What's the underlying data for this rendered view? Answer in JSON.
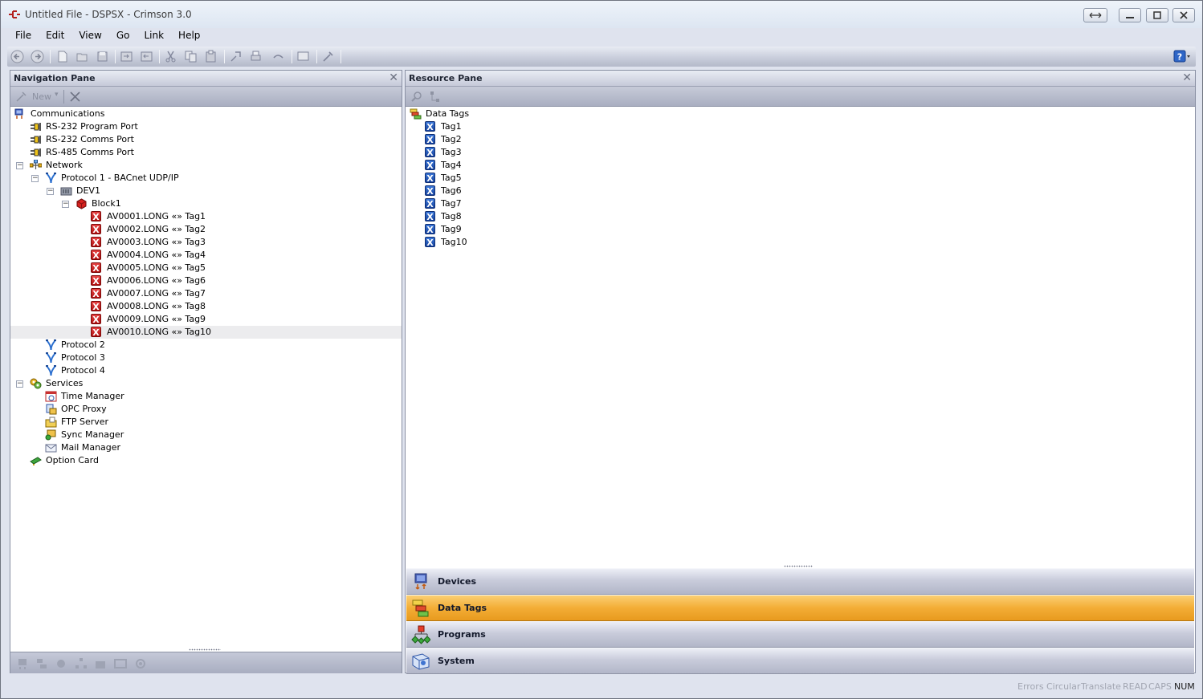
{
  "window": {
    "title": "Untitled File - DSPSX - Crimson 3.0",
    "controls": [
      "restore-down",
      "minimize",
      "maximize",
      "close"
    ]
  },
  "menu": [
    {
      "label": "File"
    },
    {
      "label": "Edit"
    },
    {
      "label": "View"
    },
    {
      "label": "Go"
    },
    {
      "label": "Link"
    },
    {
      "label": "Help"
    }
  ],
  "toolbar": {
    "icons": [
      "back-icon",
      "forward-icon",
      "new-file-icon",
      "open-icon",
      "save-icon",
      "import-icon",
      "export-icon",
      "cut-icon",
      "copy-icon",
      "paste-icon",
      "find-icon",
      "print-icon",
      "link-icon",
      "display-icon",
      "tool-icon"
    ],
    "help_icon": "help-icon"
  },
  "navigation_pane": {
    "title": "Navigation Pane",
    "new_label": "New",
    "tree": [
      {
        "label": "Communications",
        "icon": "communications-icon",
        "level": 0,
        "expander": ""
      },
      {
        "label": "RS-232 Program Port",
        "icon": "port-icon",
        "level": 1,
        "expander": ""
      },
      {
        "label": "RS-232 Comms Port",
        "icon": "port-icon",
        "level": 1,
        "expander": ""
      },
      {
        "label": "RS-485 Comms Port",
        "icon": "port-icon",
        "level": 1,
        "expander": ""
      },
      {
        "label": "Network",
        "icon": "network-icon",
        "level": 1,
        "expander": "−"
      },
      {
        "label": "Protocol 1 - BACnet UDP/IP",
        "icon": "protocol-icon",
        "level": 2,
        "expander": "−"
      },
      {
        "label": "DEV1",
        "icon": "device-icon",
        "level": 3,
        "expander": "−"
      },
      {
        "label": "Block1",
        "icon": "block-icon",
        "level": 4,
        "expander": "−"
      },
      {
        "label": "AV0001.LONG «» Tag1",
        "icon": "mapping-icon",
        "level": 5,
        "expander": ""
      },
      {
        "label": "AV0002.LONG «» Tag2",
        "icon": "mapping-icon",
        "level": 5,
        "expander": ""
      },
      {
        "label": "AV0003.LONG «» Tag3",
        "icon": "mapping-icon",
        "level": 5,
        "expander": ""
      },
      {
        "label": "AV0004.LONG «» Tag4",
        "icon": "mapping-icon",
        "level": 5,
        "expander": ""
      },
      {
        "label": "AV0005.LONG «» Tag5",
        "icon": "mapping-icon",
        "level": 5,
        "expander": ""
      },
      {
        "label": "AV0006.LONG «» Tag6",
        "icon": "mapping-icon",
        "level": 5,
        "expander": ""
      },
      {
        "label": "AV0007.LONG «» Tag7",
        "icon": "mapping-icon",
        "level": 5,
        "expander": ""
      },
      {
        "label": "AV0008.LONG «» Tag8",
        "icon": "mapping-icon",
        "level": 5,
        "expander": ""
      },
      {
        "label": "AV0009.LONG «» Tag9",
        "icon": "mapping-icon",
        "level": 5,
        "expander": ""
      },
      {
        "label": "AV0010.LONG «» Tag10",
        "icon": "mapping-icon",
        "level": 5,
        "expander": "",
        "selected": true
      },
      {
        "label": "Protocol 2",
        "icon": "protocol-icon",
        "level": 2,
        "expander": ""
      },
      {
        "label": "Protocol 3",
        "icon": "protocol-icon",
        "level": 2,
        "expander": ""
      },
      {
        "label": "Protocol 4",
        "icon": "protocol-icon",
        "level": 2,
        "expander": ""
      },
      {
        "label": "Services",
        "icon": "services-icon",
        "level": 1,
        "expander": "−"
      },
      {
        "label": "Time Manager",
        "icon": "time-manager-icon",
        "level": 2,
        "expander": ""
      },
      {
        "label": "OPC Proxy",
        "icon": "opc-proxy-icon",
        "level": 2,
        "expander": ""
      },
      {
        "label": "FTP Server",
        "icon": "ftp-server-icon",
        "level": 2,
        "expander": ""
      },
      {
        "label": "Sync Manager",
        "icon": "sync-manager-icon",
        "level": 2,
        "expander": ""
      },
      {
        "label": "Mail Manager",
        "icon": "mail-manager-icon",
        "level": 2,
        "expander": ""
      },
      {
        "label": "Option Card",
        "icon": "option-card-icon",
        "level": 1,
        "expander": ""
      }
    ],
    "bottom_icons": [
      "nav-devices-icon",
      "nav-tags-icon",
      "nav-programs-icon",
      "nav-web-icon",
      "nav-files-icon",
      "nav-display-icon",
      "nav-system-icon"
    ]
  },
  "resource_pane": {
    "title": "Resource Pane",
    "tool_icons": [
      "search-icon",
      "tree-view-icon"
    ],
    "tree": [
      {
        "label": "Data Tags",
        "icon": "data-tags-folder-icon",
        "level": 0
      },
      {
        "label": "Tag1",
        "icon": "tag-icon",
        "level": 1
      },
      {
        "label": "Tag2",
        "icon": "tag-icon",
        "level": 1
      },
      {
        "label": "Tag3",
        "icon": "tag-icon",
        "level": 1
      },
      {
        "label": "Tag4",
        "icon": "tag-icon",
        "level": 1
      },
      {
        "label": "Tag5",
        "icon": "tag-icon",
        "level": 1
      },
      {
        "label": "Tag6",
        "icon": "tag-icon",
        "level": 1
      },
      {
        "label": "Tag7",
        "icon": "tag-icon",
        "level": 1
      },
      {
        "label": "Tag8",
        "icon": "tag-icon",
        "level": 1
      },
      {
        "label": "Tag9",
        "icon": "tag-icon",
        "level": 1
      },
      {
        "label": "Tag10",
        "icon": "tag-icon",
        "level": 1
      }
    ],
    "categories": [
      {
        "label": "Devices",
        "icon": "devices-icon",
        "active": false
      },
      {
        "label": "Data Tags",
        "icon": "data-tags-icon",
        "active": true
      },
      {
        "label": "Programs",
        "icon": "programs-icon",
        "active": false
      },
      {
        "label": "System",
        "icon": "system-icon",
        "active": false
      }
    ]
  },
  "status": [
    {
      "label": "Errors",
      "on": false
    },
    {
      "label": "Circular",
      "on": false
    },
    {
      "label": "Translate",
      "on": false
    },
    {
      "label": "READ",
      "on": false
    },
    {
      "label": "CAPS",
      "on": false
    },
    {
      "label": "NUM",
      "on": true
    }
  ],
  "colors": {
    "active_category": "#f3ad36",
    "mapping_icon": "#c41616",
    "tag_icon": "#1f4fae"
  }
}
